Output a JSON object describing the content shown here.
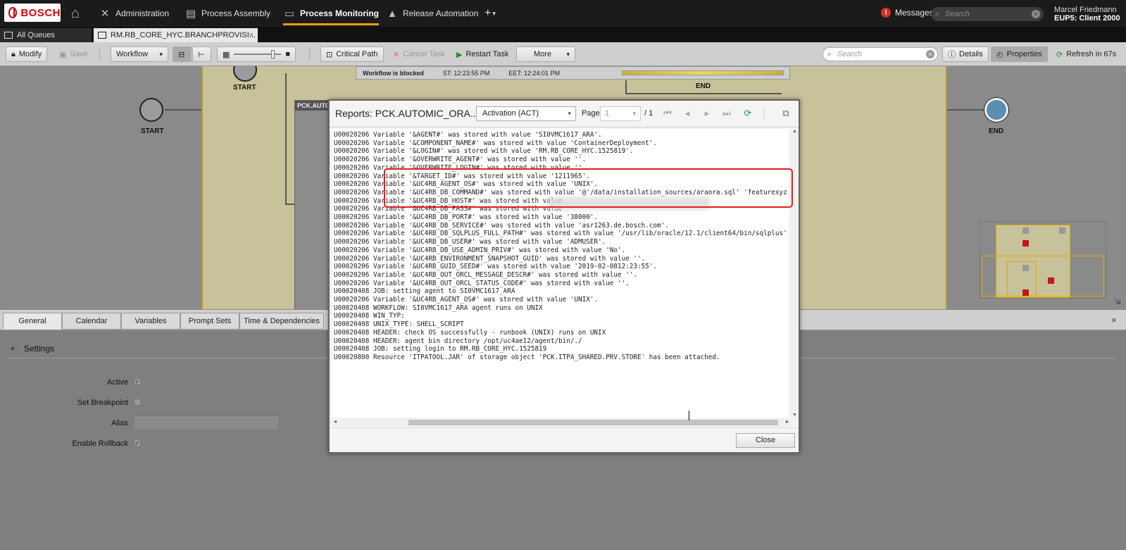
{
  "topnav": {
    "logo": "BOSCH",
    "items": [
      {
        "label": "Administration",
        "icon": "tools-icon"
      },
      {
        "label": "Process Assembly",
        "icon": "tree-icon"
      },
      {
        "label": "Process Monitoring",
        "icon": "monitor-icon"
      },
      {
        "label": "Release Automation",
        "icon": "rocket-icon"
      }
    ],
    "plus": "+",
    "messages": "Messages",
    "search_placeholder": "Search",
    "user_name": "Marcel Friedmann",
    "client": "EUP5: Client 2000"
  },
  "tabs": {
    "queues": "All Queues",
    "active": "RM.RB_CORE_HYC.BRANCHPROVISI..."
  },
  "toolbar": {
    "modify": "Modify",
    "save": "Save",
    "workflow": "Workflow",
    "critical_path": "Critical Path",
    "cancel_task": "Cancel Task",
    "restart_task": "Restart Task",
    "more": "More",
    "search_placeholder": "Search",
    "details": "Details",
    "properties": "Properties",
    "refresh": "Refresh in 67s"
  },
  "canvas": {
    "status": "Workflow is blocked",
    "st": "ST: 12:23:55 PM",
    "eet": "EET: 12:24:01 PM",
    "start_label": "START",
    "end_label": "END",
    "inner_start_label": "START",
    "inner_end_label": "END",
    "sub_box": "PCK.AUTOM"
  },
  "bottom": {
    "tabs": [
      "General",
      "Calendar",
      "Variables",
      "Prompt Sets",
      "Time & Dependencies"
    ],
    "close": "×",
    "settings": "Settings",
    "fields": {
      "active": "Active",
      "breakpoint": "Set Breakpoint",
      "alias": "Alias",
      "rollback": "Enable Rollback"
    }
  },
  "modal": {
    "title": "Reports: PCK.AUTOMIC_ORA...",
    "report_type": "Activation (ACT)",
    "page_label": "Page",
    "page_value": "1",
    "page_total": "/ 1",
    "close": "Close",
    "log": [
      "U00020206 Variable '&AGENT#' was stored with value 'SI0VMC1617_ARA'.",
      "U00020206 Variable '&COMPONENT_NAME#' was stored with value 'ContainerDeployment'.",
      "U00020206 Variable '&LOGIN#' was stored with value 'RM.RB_CORE_HYC.1525819'.",
      "U00020206 Variable '&OVERWRITE_AGENT#' was stored with value ''.",
      "U00020206 Variable '&OVERWRITE_LOGIN#' was stored with value ''.",
      "U00020206 Variable '&TARGET_ID#' was stored with value '1211965'.",
      "U00020206 Variable '&UC4RB_AGENT_OS#' was stored with value 'UNIX'.",
      "U00020206 Variable '&UC4RB_DB_COMMAND#' was stored with value '@'/data/installation_sources/araora.sql' 'featurexyz''.",
      "U00020206 Variable '&UC4RB_DB_HOST#' was stored with value",
      "U00020206 Variable '&UC4RB_DB_PASS#' was stored with value",
      "U00020206 Variable '&UC4RB_DB_PORT#' was stored with value '38000'.",
      "U00020206 Variable '&UC4RB_DB_SERVICE#' was stored with value 'asr1263.de.bosch.com'.",
      "U00020206 Variable '&UC4RB_DB_SQLPLUS_FULL_PATH#' was stored with value '/usr/lib/oracle/12.1/client64/bin/sqlplus'.",
      "U00020206 Variable '&UC4RB_DB_USER#' was stored with value 'ADMUSER'.",
      "U00020206 Variable '&UC4RB_DB_USE_ADMIN_PRIV#' was stored with value 'No'.",
      "U00020206 Variable '&UC4RB_ENVIRONMENT_SNAPSHOT_GUID' was stored with value ''.",
      "U00020206 Variable '&UC4RB_GUID_SEED#' was stored with value '2019-02-0812:23:55'.",
      "U00020206 Variable '&UC4RB_OUT_ORCL_MESSAGE_DESCR#' was stored with value ''.",
      "U00020206 Variable '&UC4RB_OUT_ORCL_STATUS_CODE#' was stored with value ''.",
      "U00020408 JOB: setting agent to SI0VMC1617_ARA",
      "U00020206 Variable '&UC4RB_AGENT_OS#' was stored with value 'UNIX'.",
      "U00020408 WORKFLOW: SI0VMC1617_ARA agent runs on UNIX",
      "U00020408 WIN_TYP:",
      "U00020408 UNIX_TYPE: SHELL_SCRIPT",
      "U00020408 HEADER: check OS successfully - runbook (UNIX) runs on UNIX",
      "U00020408 HEADER: agent bin directory /opt/uc4ae12/agent/bin/./",
      "U00020408 JOB: setting login to RM.RB_CORE_HYC.1525819",
      "U00020800 Resource 'ITPATOOL.JAR' of storage object 'PCK.ITPA_SHARED.PRV.STORE' has been attached."
    ]
  }
}
